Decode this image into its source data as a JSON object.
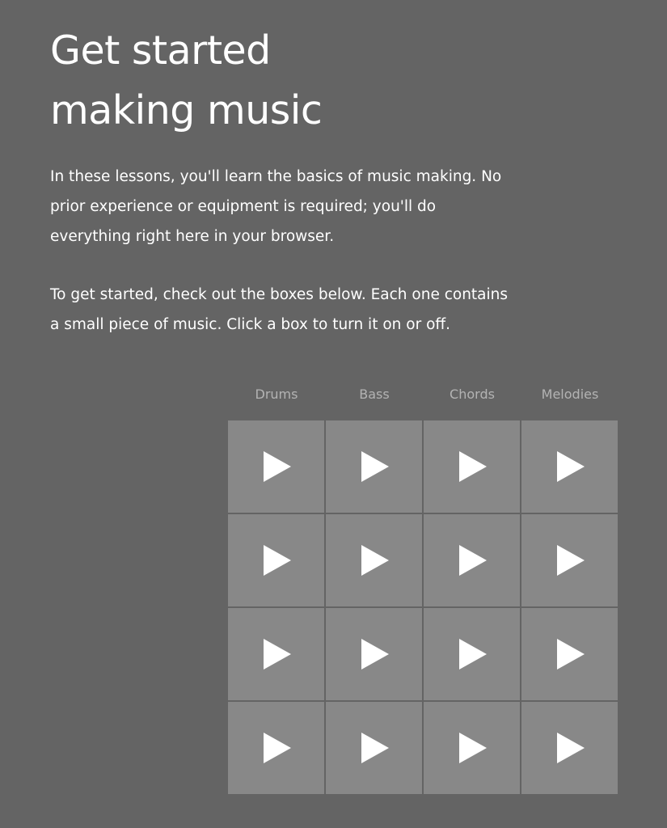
{
  "page": {
    "title_lines": [
      "Get started",
      "making music"
    ],
    "intro_lines": [
      "In these lessons, you'll learn the basics of music making. No",
      "prior experience or equipment is required; you'll do",
      "everything right here in your browser."
    ],
    "instructions_lines": [
      "To get started, check out the boxes below. Each one contains",
      "a small piece of music. Click a box to turn it on or off."
    ]
  },
  "colors": {
    "background": "#646464",
    "pad": "#888888",
    "label": "#b3b3b3",
    "text": "#ffffff"
  },
  "grid": {
    "columns": [
      "Drums",
      "Bass",
      "Chords",
      "Melodies"
    ],
    "rows": 4,
    "pad_icon": "play-icon",
    "pad_state": "off"
  }
}
